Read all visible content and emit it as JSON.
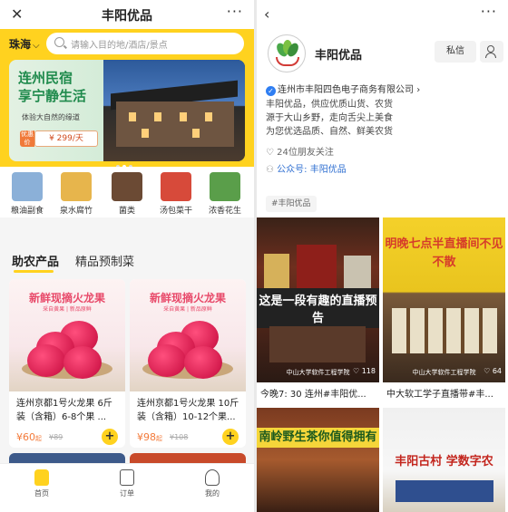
{
  "left": {
    "header": {
      "title": "丰阳优品",
      "close_icon": "close-icon",
      "more_icon": "more-dots-icon",
      "more_glyph": "···",
      "close_glyph": "✕"
    },
    "city": "珠海",
    "search": {
      "placeholder": "请输入目的地/酒店/景点"
    },
    "banner": {
      "title_line1": "连州民宿",
      "title_line2": "享宁静生活",
      "subtitle": "体验大自然的缘道",
      "price": "¥ 299/天",
      "price_tag": "优惠价"
    },
    "categories": [
      {
        "label": "粮油副食",
        "icon": "rice-bag-icon",
        "color": "#8bb0d8"
      },
      {
        "label": "泉水腐竹",
        "icon": "tofu-skin-icon",
        "color": "#e7b54c"
      },
      {
        "label": "菌类",
        "icon": "mushroom-icon",
        "color": "#6b4a34"
      },
      {
        "label": "汤包菜干",
        "icon": "soup-pack-icon",
        "color": "#d74a3a"
      },
      {
        "label": "浓香花生",
        "icon": "peanut-icon",
        "color": "#5a9e4a"
      }
    ],
    "tabs": {
      "active": "助农产品",
      "other": "精品预制菜"
    },
    "products": [
      {
        "image_title": "新鲜现摘火龙果",
        "image_sub": "采自黄果 | 新品原鲜",
        "name": "连州京都1号火龙果 6斤装（含箱）6-8个果 ...",
        "price": "¥60",
        "price_unit": "起",
        "old_price": "¥89"
      },
      {
        "image_title": "新鲜现摘火龙果",
        "image_sub": "采自黄果 | 新品原鲜",
        "name": "连州京都1号火龙果 10斤装（含箱）10-12个果...",
        "price": "¥98",
        "price_unit": "起",
        "old_price": "¥108"
      }
    ],
    "bottom_nav": [
      {
        "label": "首页",
        "icon": "home-icon",
        "active": true
      },
      {
        "label": "订单",
        "icon": "order-icon",
        "active": false
      },
      {
        "label": "我的",
        "icon": "profile-icon",
        "active": false
      }
    ],
    "colors": {
      "accent": "#ffd21f",
      "price": "#f37a3a"
    }
  },
  "right": {
    "back_glyph": "‹",
    "more_glyph": "···",
    "name": "丰阳优品",
    "message_button": "私信",
    "verified_company": "连州市丰阳四色电子商务有限公司",
    "verified_arrow": "›",
    "bio_line1": "丰阳优品，供应优质山货、农货",
    "bio_line2": "源于大山乡野，走向舌尖上美食",
    "bio_line3": "为您优选品质、自然、鲜美农货",
    "friends": "24位朋友关注",
    "official_account": "公众号: 丰阳优品",
    "hashtag": "#丰阳优品",
    "videos": [
      {
        "overlay": "这是一段有趣的直播预告",
        "school": "中山大学软件工程学院",
        "likes": "118",
        "caption": "今晚7: 30 连州#丰阳优..."
      },
      {
        "overlay": "明晚七点半直播间不见不散",
        "school": "中山大学软件工程学院",
        "likes": "64",
        "caption": "中大软工学子直播带#丰..."
      },
      {
        "overlay": "南岭野生茶你值得拥有"
      },
      {
        "overlay": "丰阳古村 学数字农"
      }
    ],
    "colors": {
      "link": "#2f6fd1",
      "verified": "#2f7ef2"
    }
  }
}
